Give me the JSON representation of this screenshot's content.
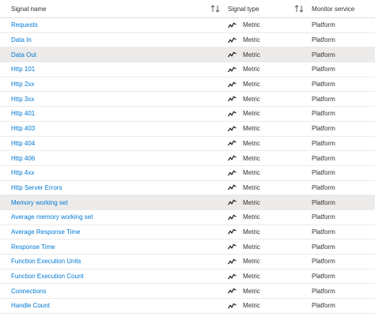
{
  "columns": {
    "signal_name": "Signal name",
    "signal_type": "Signal type",
    "monitor_service": "Monitor service"
  },
  "icons": {
    "sort": "sort-up-down-icon",
    "metric": "metric-line-icon"
  },
  "colors": {
    "link": "#0078d4",
    "selected_row": "#edebe9"
  },
  "rows": [
    {
      "name": "Requests",
      "type": "Metric",
      "service": "Platform"
    },
    {
      "name": "Data In",
      "type": "Metric",
      "service": "Platform"
    },
    {
      "name": "Data Out",
      "type": "Metric",
      "service": "Platform",
      "selected": true
    },
    {
      "name": "Http 101",
      "type": "Metric",
      "service": "Platform"
    },
    {
      "name": "Http 2xx",
      "type": "Metric",
      "service": "Platform"
    },
    {
      "name": "Http 3xx",
      "type": "Metric",
      "service": "Platform"
    },
    {
      "name": "Http 401",
      "type": "Metric",
      "service": "Platform"
    },
    {
      "name": "Http 403",
      "type": "Metric",
      "service": "Platform"
    },
    {
      "name": "Http 404",
      "type": "Metric",
      "service": "Platform"
    },
    {
      "name": "Http 406",
      "type": "Metric",
      "service": "Platform"
    },
    {
      "name": "Http 4xx",
      "type": "Metric",
      "service": "Platform"
    },
    {
      "name": "Http Server Errors",
      "type": "Metric",
      "service": "Platform"
    },
    {
      "name": "Memory working set",
      "type": "Metric",
      "service": "Platform",
      "selected": true
    },
    {
      "name": "Average memory working set",
      "type": "Metric",
      "service": "Platform"
    },
    {
      "name": "Average Response Time",
      "type": "Metric",
      "service": "Platform"
    },
    {
      "name": "Response Time",
      "type": "Metric",
      "service": "Platform"
    },
    {
      "name": "Function Execution Units",
      "type": "Metric",
      "service": "Platform"
    },
    {
      "name": "Function Execution Count",
      "type": "Metric",
      "service": "Platform"
    },
    {
      "name": "Connections",
      "type": "Metric",
      "service": "Platform"
    },
    {
      "name": "Handle Count",
      "type": "Metric",
      "service": "Platform"
    }
  ]
}
